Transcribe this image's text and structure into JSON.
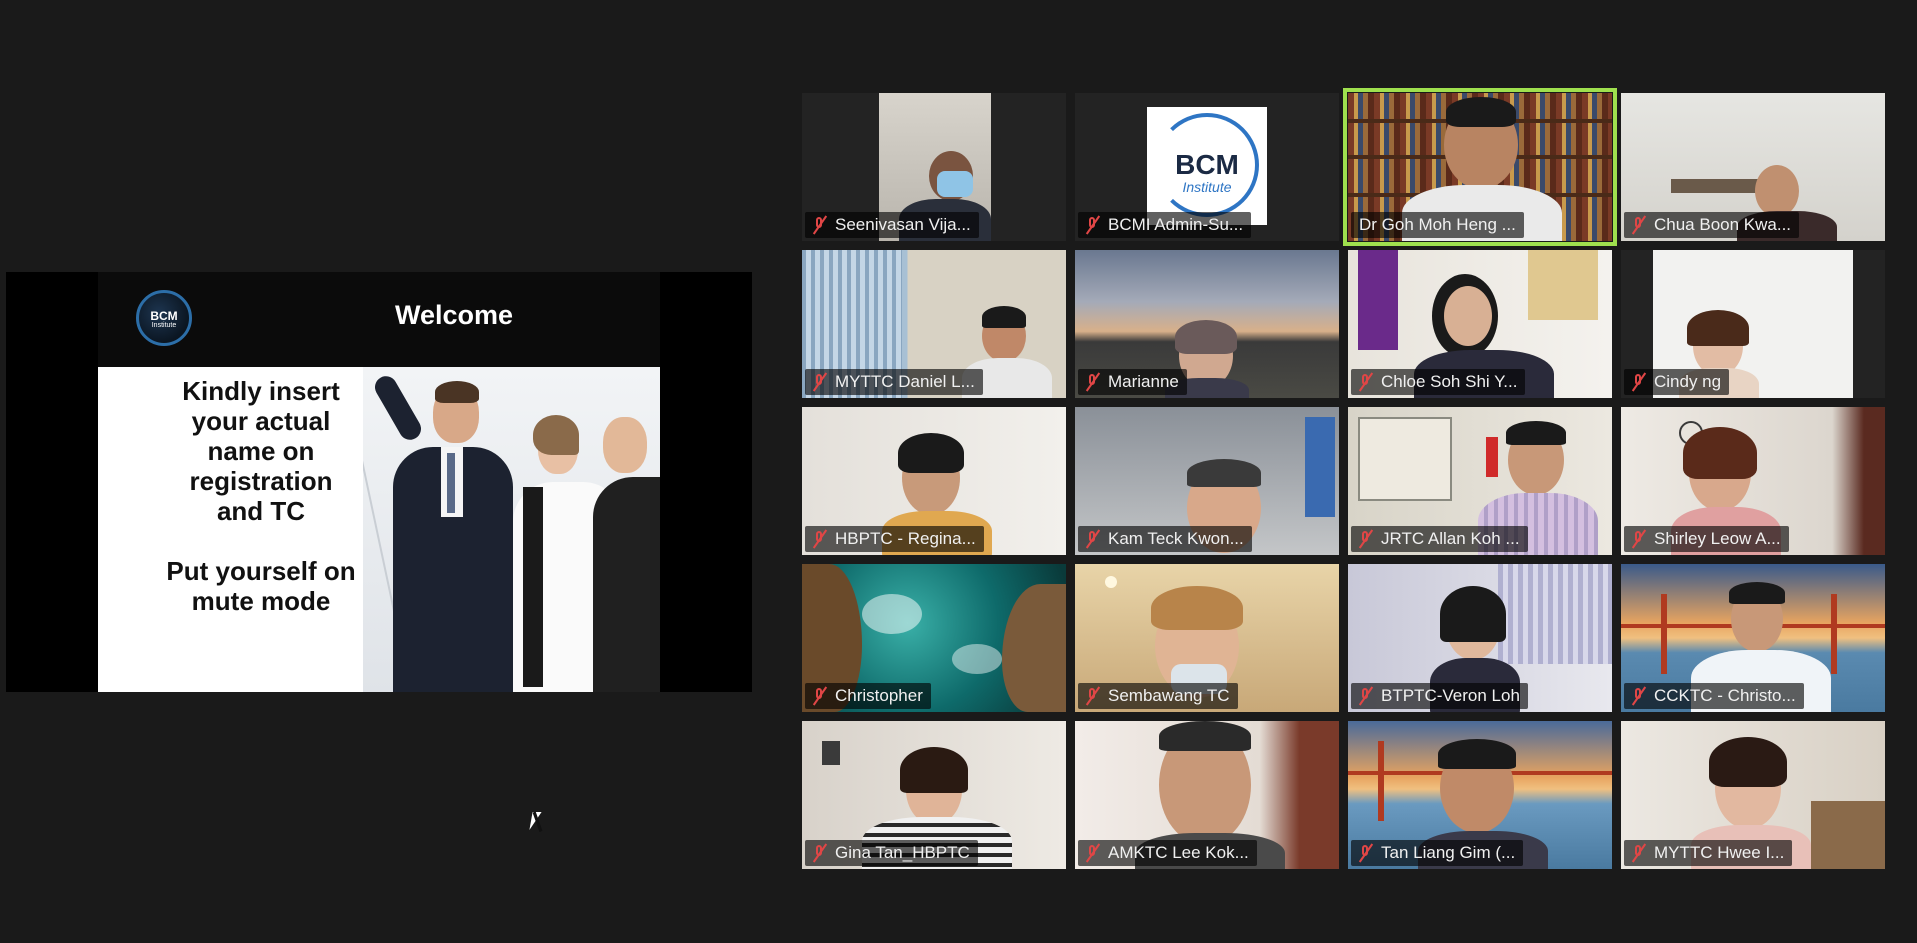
{
  "presentation": {
    "title": "Welcome",
    "logo_text": "BCM",
    "logo_subtext": "Institute",
    "line1": "Kindly insert",
    "line2": "your actual",
    "line3": "name on",
    "line4": "registration",
    "line5": "and TC",
    "line6": "Put yourself on",
    "line7": "mute mode"
  },
  "participants": [
    {
      "name": "Seenivasan Vija...",
      "muted": true
    },
    {
      "name": "BCMI Admin-Su...",
      "muted": true,
      "logo_text": "BCM",
      "logo_subtext": "Institute"
    },
    {
      "name": "Dr Goh Moh Heng ...",
      "muted": false,
      "active_speaker": true
    },
    {
      "name": "Chua Boon Kwa...",
      "muted": true
    },
    {
      "name": "MYTTC Daniel L...",
      "muted": true
    },
    {
      "name": "Marianne",
      "muted": true
    },
    {
      "name": "Chloe Soh Shi Y...",
      "muted": true
    },
    {
      "name": "Cindy ng",
      "muted": true
    },
    {
      "name": "HBPTC - Regina...",
      "muted": true
    },
    {
      "name": "Kam Teck Kwon...",
      "muted": true
    },
    {
      "name": "JRTC Allan Koh ...",
      "muted": true
    },
    {
      "name": "Shirley Leow A...",
      "muted": true
    },
    {
      "name": "Christopher",
      "muted": true
    },
    {
      "name": "Sembawang TC",
      "muted": true
    },
    {
      "name": "BTPTC-Veron Loh",
      "muted": true
    },
    {
      "name": "CCKTC - Christo...",
      "muted": true
    },
    {
      "name": "Gina Tan_HBPTC",
      "muted": true
    },
    {
      "name": "AMKTC Lee Kok...",
      "muted": true
    },
    {
      "name": "Tan Liang Gim (...",
      "muted": true
    },
    {
      "name": "MYTTC Hwee I...",
      "muted": true
    }
  ],
  "colors": {
    "background": "#1a1a1a",
    "active_speaker_border": "#9fe04e",
    "muted_icon": "#e04646"
  }
}
